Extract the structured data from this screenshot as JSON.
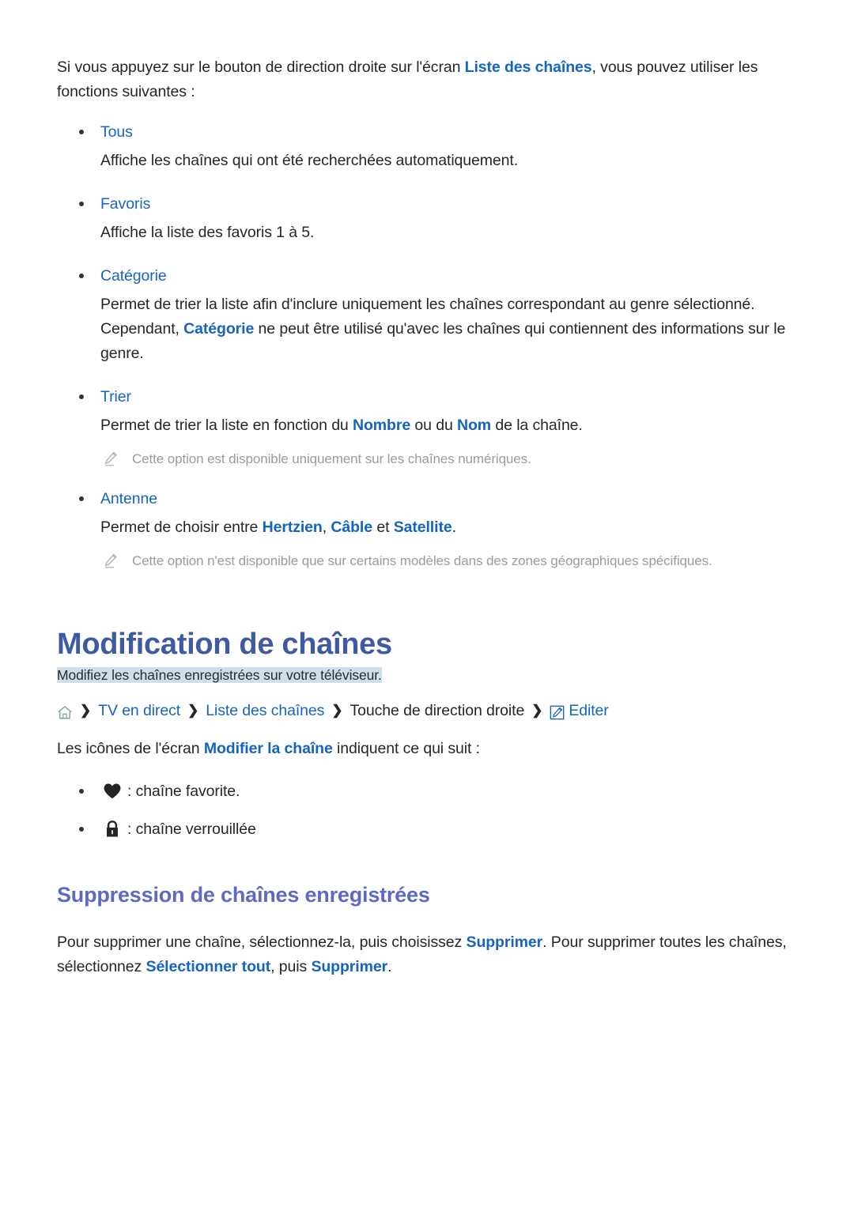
{
  "colors": {
    "link": "#1565c0",
    "h1": "#3f5aa0",
    "h2": "#5c6ac4",
    "body": "#262626",
    "note": "#9b9b9b",
    "highlight_bg": "#cfdfea"
  },
  "intro": {
    "part1": "Si vous appuyez sur le bouton de direction droite sur l'écran ",
    "link1": "Liste des chaînes",
    "part2": ", vous pouvez utiliser les fonctions suivantes :"
  },
  "options": [
    {
      "term": "Tous",
      "description": "Affiche les chaînes qui ont été recherchées automatiquement."
    },
    {
      "term": "Favoris",
      "description": "Affiche la liste des favoris 1 à 5."
    },
    {
      "term": "Catégorie",
      "desc_part1": "Permet de trier la liste afin d'inclure uniquement les chaînes correspondant au genre sélectionné. Cependant, ",
      "desc_link": "Catégorie",
      "desc_part2": " ne peut être utilisé qu'avec les chaînes qui contiennent des informations sur le genre."
    },
    {
      "term": "Trier",
      "desc_part1": "Permet de trier la liste en fonction du ",
      "desc_link1": "Nombre",
      "desc_part2": " ou du ",
      "desc_link2": "Nom",
      "desc_part3": " de la chaîne."
    },
    {
      "term": "Antenne",
      "desc_part1": "Permet de choisir entre ",
      "desc_link1": "Hertzien",
      "desc_part2": ", ",
      "desc_link2": "Câble",
      "desc_part3": " et ",
      "desc_link3": "Satellite",
      "desc_part4": "."
    }
  ],
  "notes": {
    "trier_note": "Cette option est disponible uniquement sur les chaînes numériques.",
    "antenne_note": "Cette option n'est disponible que sur certains modèles dans des zones géographiques spécifiques."
  },
  "section": {
    "h1_title": "Modification de chaînes",
    "h1_subtitle": "Modifiez les chaînes enregistrées sur votre téléviseur.",
    "breadcrumb": {
      "home_icon": "home-icon",
      "separator": "❯",
      "items": [
        {
          "label": "TV en direct",
          "type": "link"
        },
        {
          "label": "Liste des chaînes",
          "type": "link"
        },
        {
          "label": "Touche de direction droite",
          "type": "plain"
        },
        {
          "label": "Editer",
          "type": "link",
          "icon": "edit-pencil-icon"
        }
      ]
    },
    "icons_intro_part1": "Les icônes de l'écran ",
    "icons_intro_link": "Modifier la chaîne",
    "icons_intro_part2": " indiquent ce qui suit :",
    "icon_items": [
      {
        "icon": "heart-icon",
        "label": ": chaîne favorite."
      },
      {
        "icon": "lock-icon",
        "label": ": chaîne verrouillée"
      }
    ]
  },
  "subsection": {
    "h2_title": "Suppression de chaînes enregistrées",
    "body_part1": "Pour supprimer une chaîne, sélectionnez-la, puis choisissez ",
    "body_link1": "Supprimer",
    "body_part2": ". Pour supprimer toutes les chaînes, sélectionnez ",
    "body_link2": "Sélectionner tout",
    "body_part3": ", puis ",
    "body_link3": "Supprimer",
    "body_part4": "."
  }
}
